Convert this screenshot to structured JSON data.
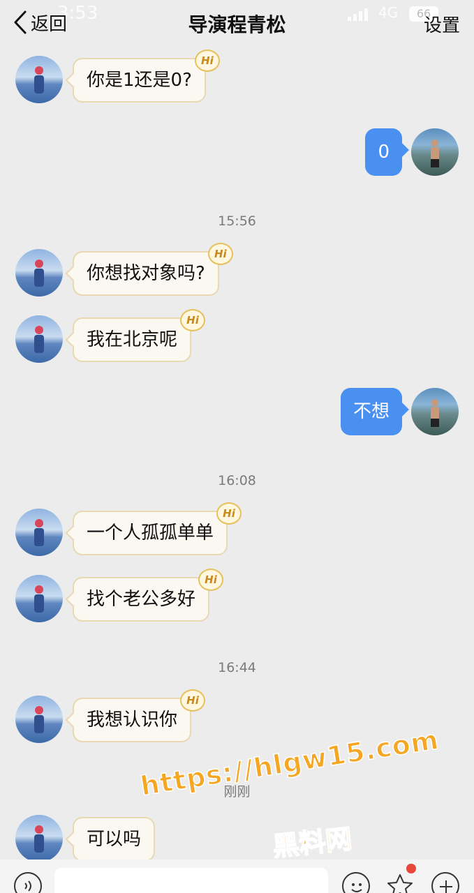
{
  "status_bar": {
    "time": "3:53",
    "network": "4G",
    "battery": "66"
  },
  "nav": {
    "back_label": "返回",
    "title": "导演程青松",
    "settings_label": "设置"
  },
  "messages": {
    "m1": "你是1还是0?",
    "m2": "0",
    "t1": "15:56",
    "m3": "你想找对象吗?",
    "m4": "我在北京呢",
    "m5": "不想",
    "t2": "16:08",
    "m6": "一个人孤孤单单",
    "m7": "找个老公多好",
    "t3": "16:44",
    "m8": "我想认识你",
    "t4": "刚刚",
    "m9": "可以吗"
  },
  "badge_label": "Hi",
  "watermark": {
    "url": "https://hlgw15.com",
    "name": "黑料网"
  },
  "colors": {
    "outgoing_bubble": "#4a90f0",
    "incoming_bubble": "#fbf8f2",
    "background": "#ececec",
    "watermark": "#f5a623"
  }
}
